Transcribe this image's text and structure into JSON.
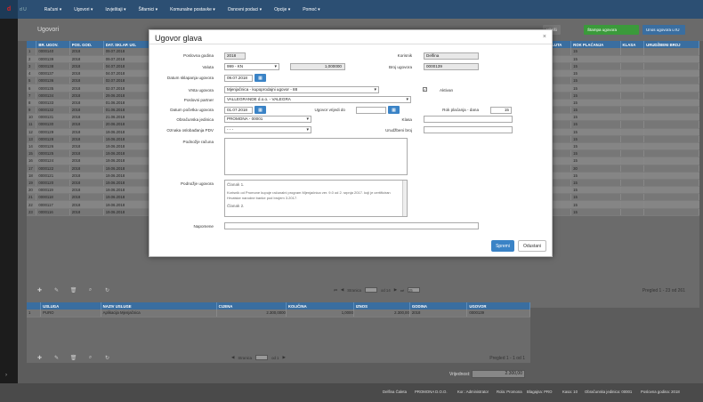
{
  "app": {
    "logo_text": "d",
    "logo_sub": "d U",
    "menu": [
      "Računi ▾",
      "Ugovori ▾",
      "Izvještaji ▾",
      "Šifarnici ▾",
      "Komunalne postavke ▾",
      "Osnovni podaci ▾",
      "Opcije ▾",
      "Pomoć ▾"
    ]
  },
  "page": {
    "title": "Ugovori",
    "btn_izbrisi": "Izbriši",
    "btn_stampa": "Štampa ugovora",
    "btn_unos": "Unos ugovora u IU"
  },
  "grid": {
    "headers": [
      "",
      "BR. UGOV.",
      "POS. GOD.",
      "DAT. SKLAP. UG.",
      "V",
      "VALUTA",
      "ROK PLAĆANJA",
      "KLASA",
      "URUDŽBENI BROJ"
    ],
    "rows": [
      [
        "1",
        "0000140",
        "2018",
        "09.07.2018",
        "",
        "KN",
        "15",
        "",
        ""
      ],
      [
        "2",
        "0000139",
        "2018",
        "09.07.2018",
        "",
        "KN",
        "15",
        "",
        ""
      ],
      [
        "3",
        "0000138",
        "2018",
        "04.07.2018",
        "",
        "KN",
        "15",
        "",
        ""
      ],
      [
        "4",
        "0000137",
        "2018",
        "04.07.2018",
        "",
        "KN",
        "15",
        "",
        ""
      ],
      [
        "5",
        "0000136",
        "2018",
        "02.07.2018",
        "",
        "KN",
        "15",
        "",
        ""
      ],
      [
        "6",
        "0000135",
        "2018",
        "02.07.2018",
        "",
        "KN",
        "15",
        "",
        ""
      ],
      [
        "7",
        "0000134",
        "2018",
        "29.06.2018",
        "",
        "KN",
        "15",
        "",
        ""
      ],
      [
        "8",
        "0000133",
        "2018",
        "01.06.2018",
        "",
        "KN",
        "15",
        "",
        ""
      ],
      [
        "9",
        "0000132",
        "2018",
        "01.06.2018",
        "",
        "KN",
        "15",
        "",
        ""
      ],
      [
        "10",
        "0000131",
        "2018",
        "21.06.2018",
        "",
        "KN",
        "15",
        "",
        ""
      ],
      [
        "11",
        "0000130",
        "2018",
        "20.06.2018",
        "",
        "KN",
        "15",
        "",
        ""
      ],
      [
        "12",
        "0000129",
        "2018",
        "19.06.2018",
        "",
        "KN",
        "15",
        "",
        ""
      ],
      [
        "13",
        "0000128",
        "2018",
        "19.06.2018",
        "",
        "KN",
        "15",
        "",
        ""
      ],
      [
        "14",
        "0000126",
        "2018",
        "19.06.2018",
        "",
        "KN",
        "15",
        "",
        ""
      ],
      [
        "15",
        "0000125",
        "2018",
        "19.06.2018",
        "",
        "KN",
        "15",
        "",
        ""
      ],
      [
        "16",
        "0000124",
        "2018",
        "19.06.2018",
        "",
        "KN",
        "15",
        "",
        ""
      ],
      [
        "17",
        "0000122",
        "2018",
        "19.06.2018",
        "",
        "KN",
        "30",
        "",
        ""
      ],
      [
        "18",
        "0000121",
        "2018",
        "19.06.2018",
        "",
        "KN",
        "15",
        "",
        ""
      ],
      [
        "19",
        "0000120",
        "2018",
        "19.06.2018",
        "",
        "KN",
        "15",
        "",
        ""
      ],
      [
        "20",
        "0000119",
        "2018",
        "19.06.2018",
        "",
        "KN",
        "15",
        "",
        ""
      ],
      [
        "21",
        "0000118",
        "2018",
        "19.06.2018",
        "",
        "KN",
        "15",
        "",
        ""
      ],
      [
        "22",
        "0000117",
        "2018",
        "19.06.2018",
        "",
        "KN",
        "15",
        "",
        ""
      ],
      [
        "23",
        "0000116",
        "2018",
        "19.06.2018",
        "",
        "KN",
        "15",
        "",
        ""
      ]
    ],
    "pager_label": "Stranica",
    "pager_of": "od 14",
    "pager_size": "15",
    "pager_info": "Pregled 1 - 23 od 261"
  },
  "grid2": {
    "headers": [
      "USLUGA",
      "NAZIV USLUGE",
      "CIJENA",
      "KOLIČINA",
      "IZNOS",
      "GODINA",
      "UGOVOR"
    ],
    "rows": [
      [
        "1",
        "PURO",
        "Aplikacija Mjenjačnica",
        "2.300,0000",
        "1,0000",
        "2.300,00",
        "2018",
        "0000139"
      ]
    ],
    "pager_label": "Stranica",
    "pager_of": "od 1",
    "pager_info": "Pregled 1 - 1 od 1",
    "total_label": "Vrijednost:",
    "total_value": "2.300,00"
  },
  "status": {
    "user": "Delfina Čaleta",
    "company": "PROMONA D.O.O.",
    "korisnik": "Kor.: Administrator",
    "role": "Rola: Promona",
    "blagajna": "Blagajna: PRO",
    "kasa": "Kasa: 10",
    "jedinica": "Obračunska jedinica: 00001",
    "godina": "Poslovna godina: 2018"
  },
  "modal": {
    "title": "Ugovor glava",
    "close": "×",
    "fields": {
      "poslovna_godina_label": "Poslovna godina",
      "poslovna_godina": "2018",
      "korisnik_label": "Korisnik",
      "korisnik": "Delfina",
      "valuta_label": "Valuta",
      "valuta": "999 - KN",
      "tecaj": "1,000000",
      "broj_ugovora_label": "Broj ugovora",
      "broj_ugovora": "0000139",
      "datum_sklapanja_label": "Datum sklapanja ugovora",
      "datum_sklapanja": "09.07.2018",
      "vrsta_ugovora_label": "Vrsta ugovora",
      "vrsta_ugovora": "Mjenjačnica - kupoprodajni ugovor - 88",
      "aktivan_label": "Aktivan",
      "poslovni_partner_label": "Poslovni partner",
      "poslovni_partner": "VALLEGRANDE d.o.o. - VALEGRA",
      "datum_pocetka_label": "Datum početka ugovora",
      "datum_pocetka": "01.07.2018",
      "ugovor_vrijedi_label": "Ugovor vrijedi do",
      "ugovor_vrijedi": "",
      "rok_placanja_label": "Rok plaćanja - dana",
      "rok_placanja": "15",
      "obracunska_label": "Obračunska jedinica",
      "obracunska": "PROMONA - 00001",
      "klasa_label": "Klasa",
      "klasa": "",
      "oznaka_pdv_label": "Oznaka oslobađanja PDV",
      "oznaka_pdv": "- - -",
      "urudzbeni_label": "Urudžbeni broj",
      "urudzbeni": "",
      "podnozje_racuna_label": "Podnožje računa",
      "podnozje_ugovora_label": "Podnožje ugovora",
      "podnozje_ugovora_l1": "Članak 1.",
      "podnozje_ugovora_l2": "Korisnik od Promone kupuje računalni program Mjenjačnica ver. 9.0 od 2. srpnja 2017. koji je certificiran Hrvatske narodne banke pod brojem 3.2017.",
      "podnozje_ugovora_l3": "Članak 2.",
      "napomene_label": "Napomene"
    },
    "btn_spremi": "Spremi",
    "btn_odustani": "Odustani"
  },
  "colors": {
    "topbar": "#2c4f73",
    "grid_header": "#3a6ea0",
    "primary_btn": "#3a83c6",
    "green_btn": "#3b9a3b"
  }
}
